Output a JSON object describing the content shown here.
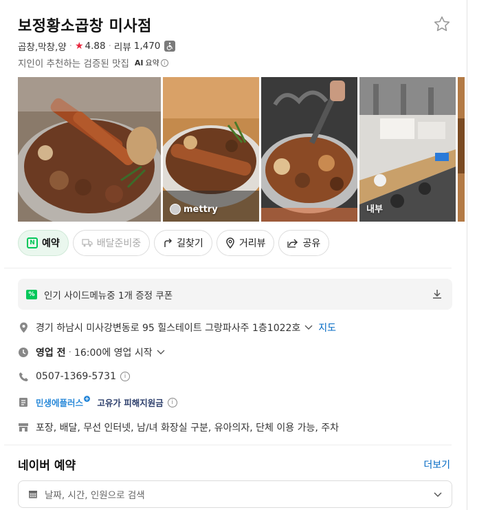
{
  "place": {
    "name": "보정황소곱창 미사점",
    "category": "곱창,막창,양",
    "rating": "4.88",
    "review_label": "리뷰",
    "review_count": "1,470",
    "tagline": "지인이 추천하는 검증된 맛집",
    "ai_badge": "AI",
    "ai_label": "요약"
  },
  "photos": [
    {
      "label": ""
    },
    {
      "label": "mettry"
    },
    {
      "label": ""
    },
    {
      "label": "내부"
    },
    {
      "label": ""
    }
  ],
  "actions": {
    "reserve": "예약",
    "delivery": "배달준비중",
    "directions": "길찾기",
    "street_view": "거리뷰",
    "share": "공유"
  },
  "coupon": {
    "text": "인기 사이드메뉴중 1개 증정 쿠폰"
  },
  "info": {
    "address": "경기 하남시 미사강변동로 95 힐스테이트 그랑파사주 1층1022호",
    "map_link": "지도",
    "status": "영업 전",
    "status_detail": "16:00에 영업 시작",
    "phone": "0507-1369-5731",
    "promo_brand": "민생에플러스",
    "promo_text": "고유가 피해지원금",
    "amenities": "포장, 배달, 무선 인터넷, 남/녀 화장실 구분, 유아의자, 단체 이용 가능, 주차"
  },
  "booking": {
    "title": "네이버 예약",
    "more": "더보기",
    "search_placeholder": "날짜, 시간, 인원으로 검색"
  },
  "colors": {
    "accent_green": "#03c75a",
    "link_blue": "#0068c3",
    "rating_red": "#e8263d"
  }
}
